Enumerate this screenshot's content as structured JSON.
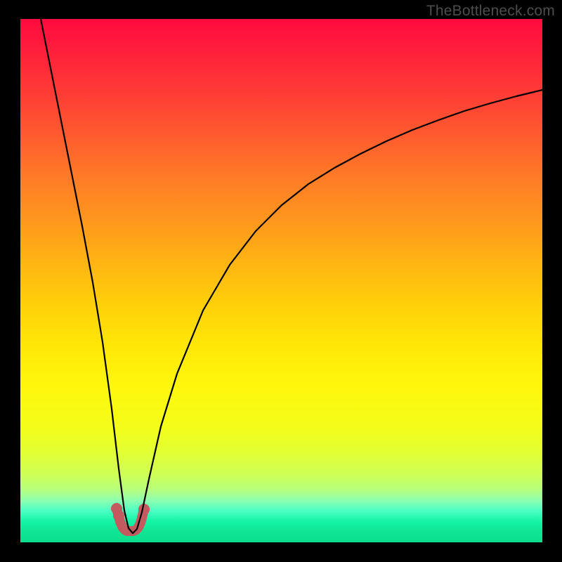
{
  "watermark": {
    "text": "TheBottleneck.com"
  },
  "colors": {
    "curve": "#000000",
    "tip": "#c35a5f",
    "frame": "#000000"
  },
  "chart_data": {
    "type": "line",
    "title": "",
    "xlabel": "",
    "ylabel": "",
    "xlim": [
      0,
      100
    ],
    "ylim": [
      0,
      100
    ],
    "grid": false,
    "legend": false,
    "background_gradient": {
      "direction": "vertical",
      "stops": [
        {
          "pos": 0,
          "color": "#ff0a3e"
        },
        {
          "pos": 50,
          "color": "#ffb213"
        },
        {
          "pos": 80,
          "color": "#f4fd1a"
        },
        {
          "pos": 100,
          "color": "#0adf8e"
        }
      ]
    },
    "series": [
      {
        "name": "bottleneck-curve",
        "x": [
          4,
          6,
          8,
          10,
          12,
          14,
          16,
          18,
          19,
          20,
          21,
          22,
          23,
          24,
          25,
          27,
          30,
          35,
          40,
          45,
          50,
          55,
          60,
          65,
          70,
          75,
          80,
          85,
          90,
          95,
          100
        ],
        "y": [
          100,
          90,
          80,
          70,
          60,
          49,
          38,
          24,
          14,
          6,
          3,
          2,
          3,
          6,
          12,
          22,
          32,
          44,
          53,
          59,
          64,
          68,
          71,
          74,
          76.5,
          78.5,
          80.3,
          82,
          83.5,
          84.8,
          86
        ]
      }
    ],
    "highlighted_region": {
      "name": "optimal-tip",
      "x_range": [
        19.2,
        24.2
      ],
      "approx_y": 2
    }
  }
}
